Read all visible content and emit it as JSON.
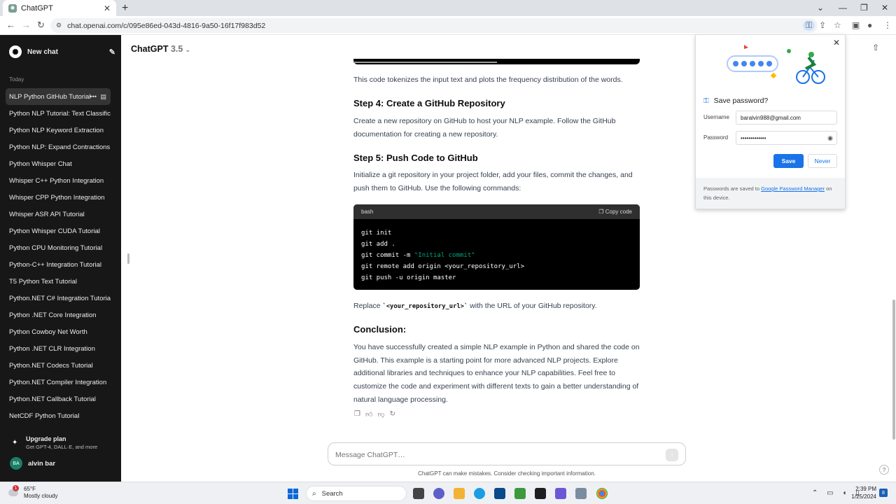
{
  "browser": {
    "tab_title": "ChatGPT",
    "url": "chat.openai.com/c/095e86ed-043d-4816-9a50-16f17f983d52"
  },
  "sidebar": {
    "new_chat": "New chat",
    "section_today": "Today",
    "conversations": [
      "NLP Python GitHub Tutorial",
      "Python NLP Tutorial: Text Classification",
      "Python NLP Keyword Extraction",
      "Python NLP: Expand Contractions",
      "Python Whisper Chat",
      "Whisper C++ Python Integration",
      "Whisper CPP Python Integration",
      "Whisper ASR API Tutorial",
      "Python Whisper CUDA Tutorial",
      "Python CPU Monitoring Tutorial",
      "Python-C++ Integration Tutorial",
      "T5 Python Text Tutorial",
      "Python.NET C# Integration Tutorial",
      "Python .NET Core Integration",
      "Python Cowboy Net Worth",
      "Python .NET CLR Integration",
      "Python.NET Codecs Tutorial",
      "Python.NET Compiler Integration",
      "Python.NET Callback Tutorial",
      "NetCDF Python Tutorial"
    ],
    "upgrade_title": "Upgrade plan",
    "upgrade_sub": "Get GPT-4, DALL·E, and more",
    "user_initials": "BA",
    "user_name": "alvin bar"
  },
  "header": {
    "model": "ChatGPT",
    "version": "3.5"
  },
  "chat": {
    "p_tokenize": "This code tokenizes the input text and plots the frequency distribution of the words.",
    "step4_heading": "Step 4: Create a GitHub Repository",
    "step4_text": "Create a new repository on GitHub to host your NLP example. Follow the GitHub documentation for creating a new repository.",
    "step5_heading": "Step 5: Push Code to GitHub",
    "step5_text": "Initialize a git repository in your project folder, add your files, commit the changes, and push them to GitHub. Use the following commands:",
    "code_lang": "bash",
    "copy_code": "Copy code",
    "code_lines": {
      "l1": "git init",
      "l2": "git add .",
      "l3_cmd": "git commit -m ",
      "l3_str": "\"Initial commit\"",
      "l4": "git remote add origin <your_repository_url>",
      "l5": "git push -u origin master"
    },
    "replace_pre": "Replace ",
    "replace_code": "`<your_repository_url>`",
    "replace_post": " with the URL of your GitHub repository.",
    "conclusion_heading": "Conclusion:",
    "conclusion_text": "You have successfully created a simple NLP example in Python and shared the code on GitHub. This example is a starting point for more advanced NLP projects. Explore additional libraries and techniques to enhance your NLP capabilities. Feel free to customize the code and experiment with different texts to gain a better understanding of natural language processing."
  },
  "composer": {
    "placeholder": "Message ChatGPT…",
    "disclaimer": "ChatGPT can make mistakes. Consider checking important information."
  },
  "password_popup": {
    "title": "Save password?",
    "username_label": "Username",
    "username_value": "baralvin988@gmail.com",
    "password_label": "Password",
    "password_value": "•••••••••••••",
    "save": "Save",
    "never": "Never",
    "footer_pre": "Passwords are saved to ",
    "footer_link": "Google Password Manager",
    "footer_post": " on this device."
  },
  "taskbar": {
    "temp": "65°F",
    "condition": "Mostly cloudy",
    "weather_badge": "1",
    "search": "Search",
    "time": "2:39 PM",
    "date": "1/25/2024",
    "notif_count": "8"
  }
}
